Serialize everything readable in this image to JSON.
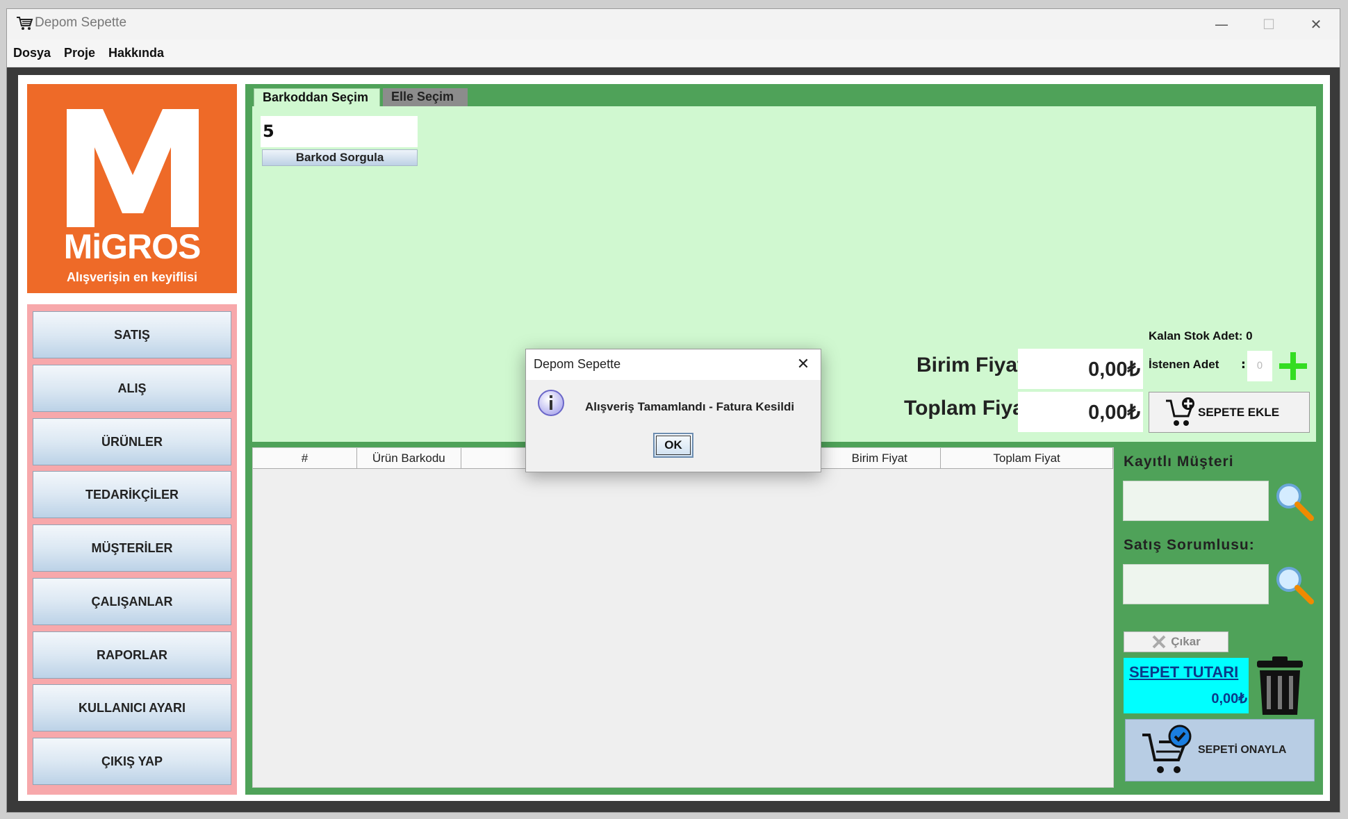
{
  "window": {
    "title": "Depom Sepette",
    "minimize": "—",
    "maximize": "☐",
    "close": "✕"
  },
  "menu": [
    "Dosya",
    "Proje",
    "Hakkında"
  ],
  "logo": {
    "brand": "MiGROS",
    "slogan": "Alışverişin en keyiflisi",
    "color": "#ee6a28"
  },
  "nav": {
    "items": [
      "SATIŞ",
      "ALIŞ",
      "ÜRÜNLER",
      "TEDARİKÇİLER",
      "MÜŞTERİLER",
      "ÇALIŞANLAR",
      "RAPORLAR",
      "KULLANICI AYARI",
      "ÇIKIŞ YAP"
    ]
  },
  "tabs": {
    "active": "Barkoddan Seçim",
    "inactive": "Elle Seçim"
  },
  "barcode": {
    "value": "5",
    "button": "Barkod Sorgula"
  },
  "stock": {
    "remaining_label": "Kalan Stok Adet: 0",
    "requested_label": "İstenen Adet",
    "colon": ":",
    "requested_value": "0"
  },
  "prices": {
    "unit_label": "Birim Fiyatı:",
    "unit_value": "0,00₺",
    "total_label": "Toplam Fiyat:",
    "total_value": "0,00₺"
  },
  "add_to_cart": "SEPETE EKLE",
  "table": {
    "headers": [
      "#",
      "Ürün Barkodu",
      "",
      "",
      "",
      "Birim Fiyat",
      "Toplam Fiyat"
    ]
  },
  "customer": {
    "label": "Kayıtlı Müşteri",
    "value": ""
  },
  "sales_rep": {
    "label": "Satış Sorumlusu:",
    "value": ""
  },
  "remove_button": "Çıkar",
  "cart_total": {
    "title": "SEPET TUTARI",
    "value": "0,00₺"
  },
  "confirm_button": "SEPETİ ONAYLA",
  "dialog": {
    "title": "Depom Sepette",
    "message": "Alışveriş Tamamlandı - Fatura Kesildi",
    "ok": "OK",
    "close": "✕"
  },
  "colors": {
    "main_green": "#4fa259",
    "light_green": "#d0f8d0",
    "nav_pink": "#f7a8ab",
    "cyan": "#00ffff"
  }
}
